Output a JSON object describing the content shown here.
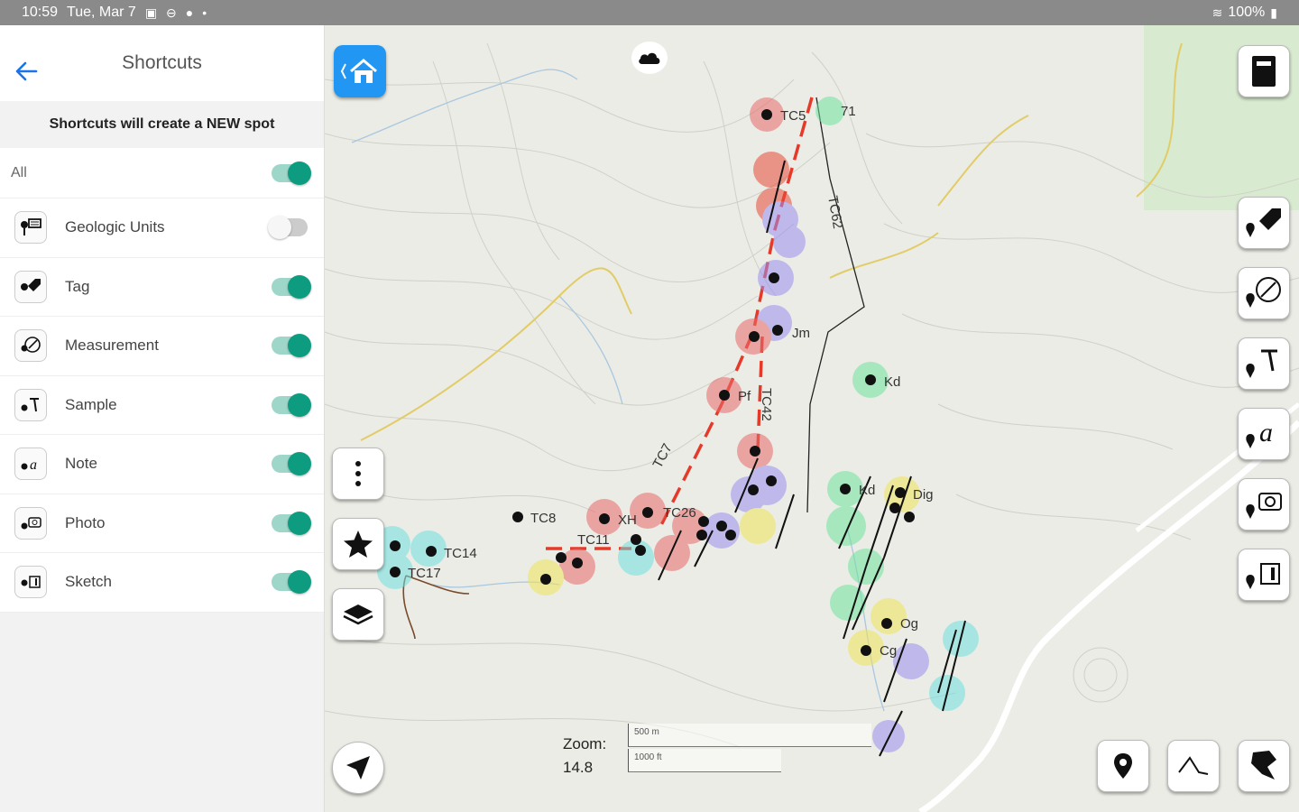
{
  "status": {
    "time": "10:59",
    "date": "Tue, Mar 7",
    "battery": "100%"
  },
  "sidebar": {
    "title": "Shortcuts",
    "banner": "Shortcuts will create a NEW spot",
    "all_label": "All",
    "all_on": true,
    "items": [
      {
        "label": "Geologic Units",
        "icon": "geologic-units-icon",
        "on": false
      },
      {
        "label": "Tag",
        "icon": "tag-icon",
        "on": true
      },
      {
        "label": "Measurement",
        "icon": "measurement-icon",
        "on": true
      },
      {
        "label": "Sample",
        "icon": "sample-icon",
        "on": true
      },
      {
        "label": "Note",
        "icon": "note-icon",
        "on": true
      },
      {
        "label": "Photo",
        "icon": "photo-icon",
        "on": true
      },
      {
        "label": "Sketch",
        "icon": "sketch-icon",
        "on": true
      }
    ]
  },
  "map": {
    "zoom_label": "Zoom:",
    "zoom_value": "14.8",
    "scale_top": "500 m",
    "scale_bottom": "1000 ft",
    "labels": [
      "TC5",
      "71",
      "TC62",
      "Kd",
      "Pf",
      "TC42",
      "TC7",
      "Jm",
      "Kd",
      "Dig",
      "TC8",
      "TC14",
      "TC17",
      "TC26",
      "XH",
      "TC11",
      "Og",
      "Cg"
    ],
    "colors": {
      "accent": "#0d9c80",
      "home": "#2196f3",
      "contour": "#c9ccc4",
      "road_yellow": "#e6cf6b"
    }
  }
}
